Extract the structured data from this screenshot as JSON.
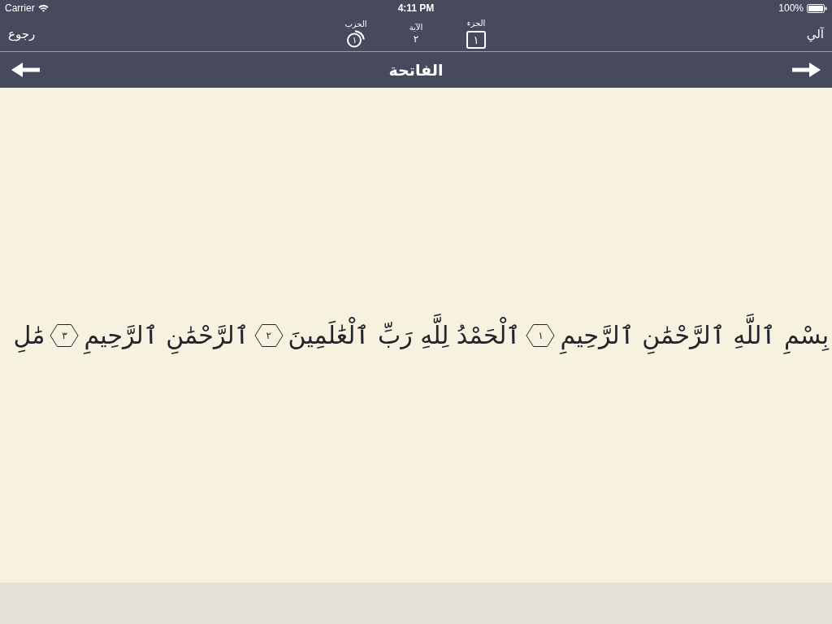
{
  "status_bar": {
    "carrier": "Carrier",
    "time": "4:11 PM",
    "battery": "100%"
  },
  "nav_bar": {
    "back_button": "رجوع",
    "right_button": "آلي",
    "indicators": [
      {
        "kind": "juz",
        "label": "الجزء",
        "value": "١"
      },
      {
        "kind": "ayah",
        "label": "الآية",
        "value": "٢"
      },
      {
        "kind": "hizb",
        "label": "الحزب",
        "value": "١"
      }
    ]
  },
  "surah_bar": {
    "title": "الفاتحة"
  },
  "verses": [
    {
      "text": "بِسْمِ ٱللَّهِ ٱلرَّحْمَٰنِ ٱلرَّحِيمِ",
      "number": "١"
    },
    {
      "text": "ٱلْحَمْدُ لِلَّهِ رَبِّ ٱلْعَٰلَمِينَ",
      "number": "٢"
    },
    {
      "text": "ٱلرَّحْمَٰنِ ٱلرَّحِيمِ",
      "number": "٣"
    },
    {
      "text": "مَٰلِ"
    }
  ]
}
